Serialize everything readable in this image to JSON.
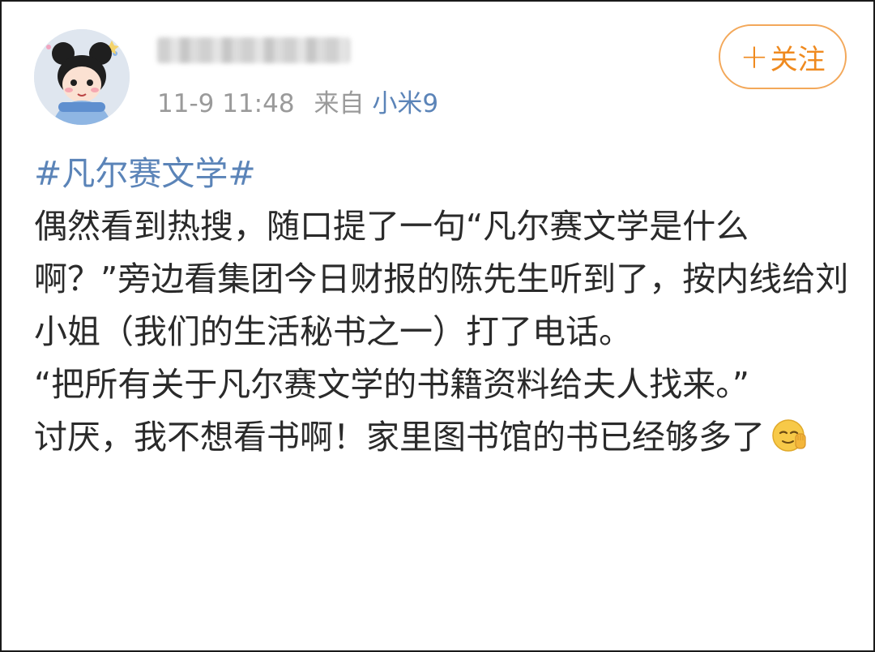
{
  "post": {
    "timestamp": "11-9 11:48",
    "source_label": "来自",
    "device": "小米9",
    "follow_button": {
      "plus": "+",
      "label": "关注"
    },
    "hashtag": "#凡尔赛文学#",
    "paragraphs": [
      "偶然看到热搜，随口提了一句“凡尔赛文学是什么啊？”旁边看集团今日财报的陈先生听到了，按内线给刘小姐（我们的生活秘书之一）打了电话。",
      "“把所有关于凡尔赛文学的书籍资料给夫人找来。”",
      "讨厌，我不想看书啊！家里图书馆的书已经够多了"
    ],
    "emoji": "waving-face-emoji"
  }
}
